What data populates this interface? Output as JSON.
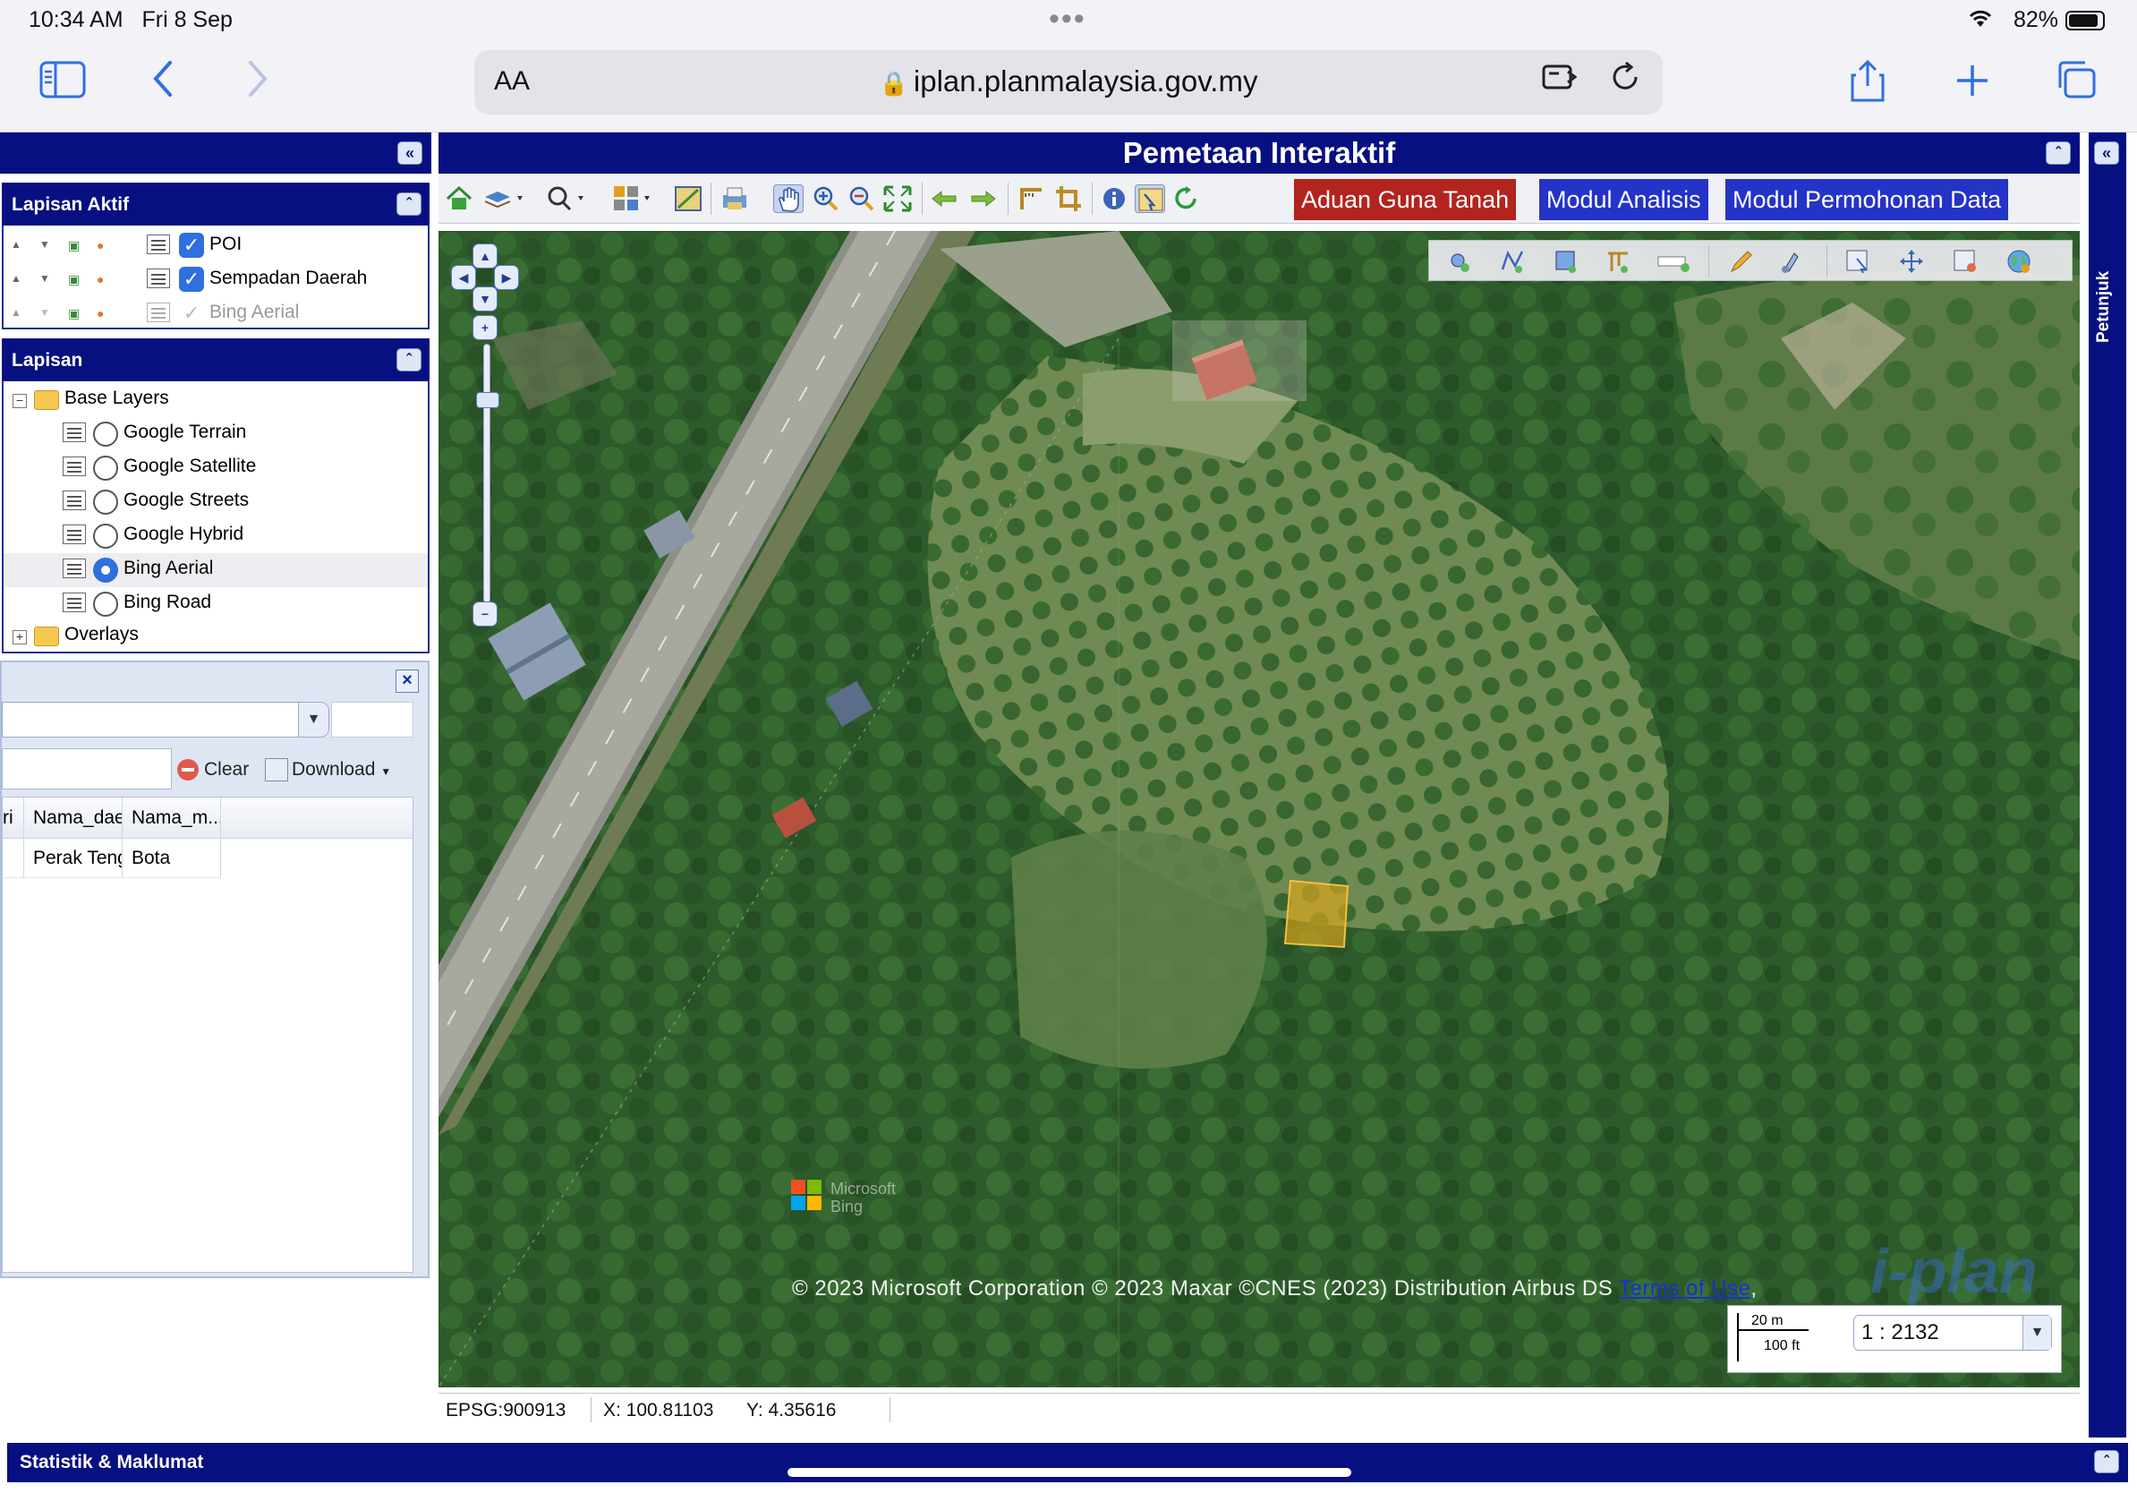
{
  "status_bar": {
    "time": "10:34 AM",
    "date": "Fri 8 Sep",
    "battery": "82%",
    "dots": "•••"
  },
  "browser": {
    "text_size_label": "AA",
    "url": "iplan.planmalaysia.gov.my",
    "icons": [
      "sidebar-icon",
      "back-icon",
      "forward-icon",
      "lock-icon",
      "extension-icon",
      "reload-icon",
      "share-icon",
      "new-tab-icon",
      "tabs-icon"
    ]
  },
  "left_panel": {
    "active_layers": {
      "title": "Lapisan Aktif",
      "items": [
        {
          "label": "POI",
          "checked": true
        },
        {
          "label": "Sempadan Daerah",
          "checked": true
        },
        {
          "label": "Bing Aerial",
          "checked": false,
          "dimmed": true
        }
      ]
    },
    "layers": {
      "title": "Lapisan",
      "base_folder": "Base Layers",
      "base_layers": [
        {
          "label": "Google Terrain",
          "selected": false
        },
        {
          "label": "Google Satellite",
          "selected": false
        },
        {
          "label": "Google Streets",
          "selected": false
        },
        {
          "label": "Google Hybrid",
          "selected": false
        },
        {
          "label": "Bing Aerial",
          "selected": true
        },
        {
          "label": "Bing Road",
          "selected": false
        }
      ],
      "overlay_folder": "Overlays"
    },
    "attributes": {
      "clear_label": "Clear",
      "download_label": "Download",
      "columns": [
        "ri",
        "Nama_daerah",
        "Nama_m..."
      ],
      "rows": [
        [
          "",
          "Perak Tengah",
          "Bota"
        ]
      ]
    }
  },
  "map": {
    "title": "Pemetaan Interaktif",
    "modules": [
      {
        "label": "Aduan Guna Tanah",
        "color": "#b3241f"
      },
      {
        "label": "Modul Analisis",
        "color": "#2433c8"
      },
      {
        "label": "Modul Permohonan Data",
        "color": "#2433c8"
      }
    ],
    "bing_logo_text": "Microsoft Bing",
    "attribution": "© 2023 Microsoft Corporation © 2023 Maxar ©CNES (2023) Distribution Airbus DS",
    "terms_link": "Terms of Use",
    "watermark": "i-plan",
    "scale": {
      "metric": "20 m",
      "imperial": "100 ft",
      "ratio": "1 : 2132"
    },
    "highlight_color": "#e0a81c"
  },
  "coord_bar": {
    "epsg": "EPSG:900913",
    "x": "X: 100.81103",
    "y": "Y: 4.35616"
  },
  "right_panel": {
    "label": "Petunjuk"
  },
  "bottom_bar": {
    "label": "Statistik & Maklumat"
  }
}
